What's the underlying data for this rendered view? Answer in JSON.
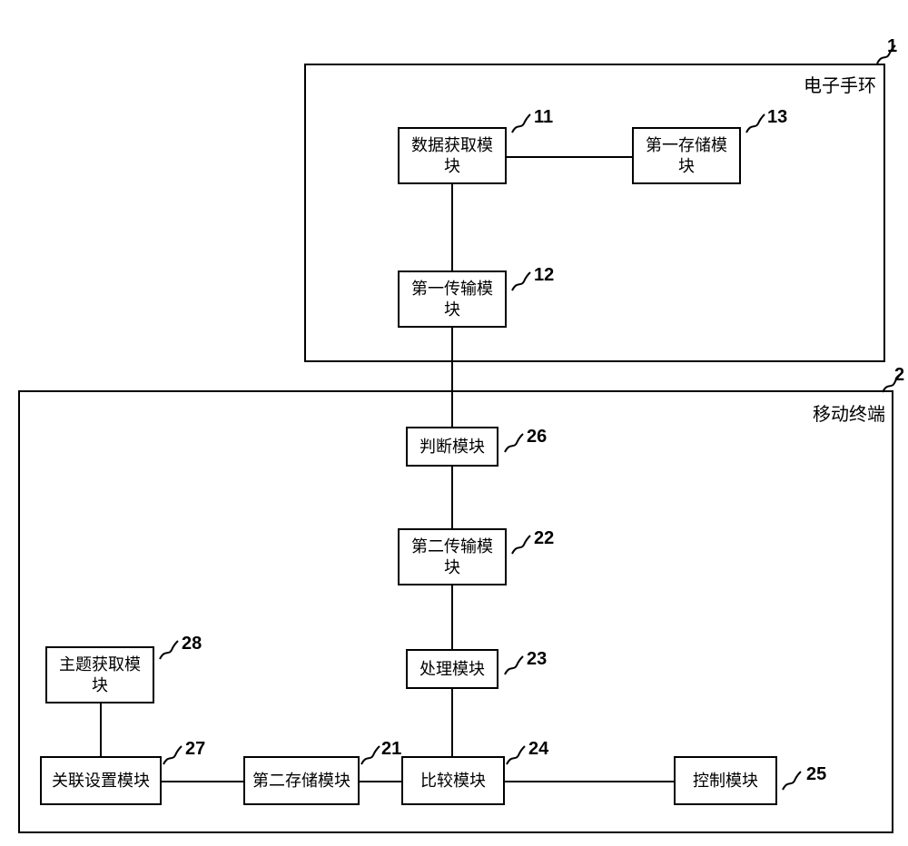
{
  "containers": {
    "top": {
      "label": "电子手环",
      "ref": "1"
    },
    "bottom": {
      "label": "移动终端",
      "ref": "2"
    }
  },
  "boxes": {
    "b11": {
      "label": "数据获取模块",
      "ref": "11"
    },
    "b13": {
      "label": "第一存储模块",
      "ref": "13"
    },
    "b12": {
      "label": "第一传输模块",
      "ref": "12"
    },
    "b26": {
      "label": "判断模块",
      "ref": "26"
    },
    "b22": {
      "label": "第二传输模块",
      "ref": "22"
    },
    "b23": {
      "label": "处理模块",
      "ref": "23"
    },
    "b28": {
      "label": "主题获取模块",
      "ref": "28"
    },
    "b27": {
      "label": "关联设置模块",
      "ref": "27"
    },
    "b21": {
      "label": "第二存储模块",
      "ref": "21"
    },
    "b24": {
      "label": "比较模块",
      "ref": "24"
    },
    "b25": {
      "label": "控制模块",
      "ref": "25"
    }
  }
}
